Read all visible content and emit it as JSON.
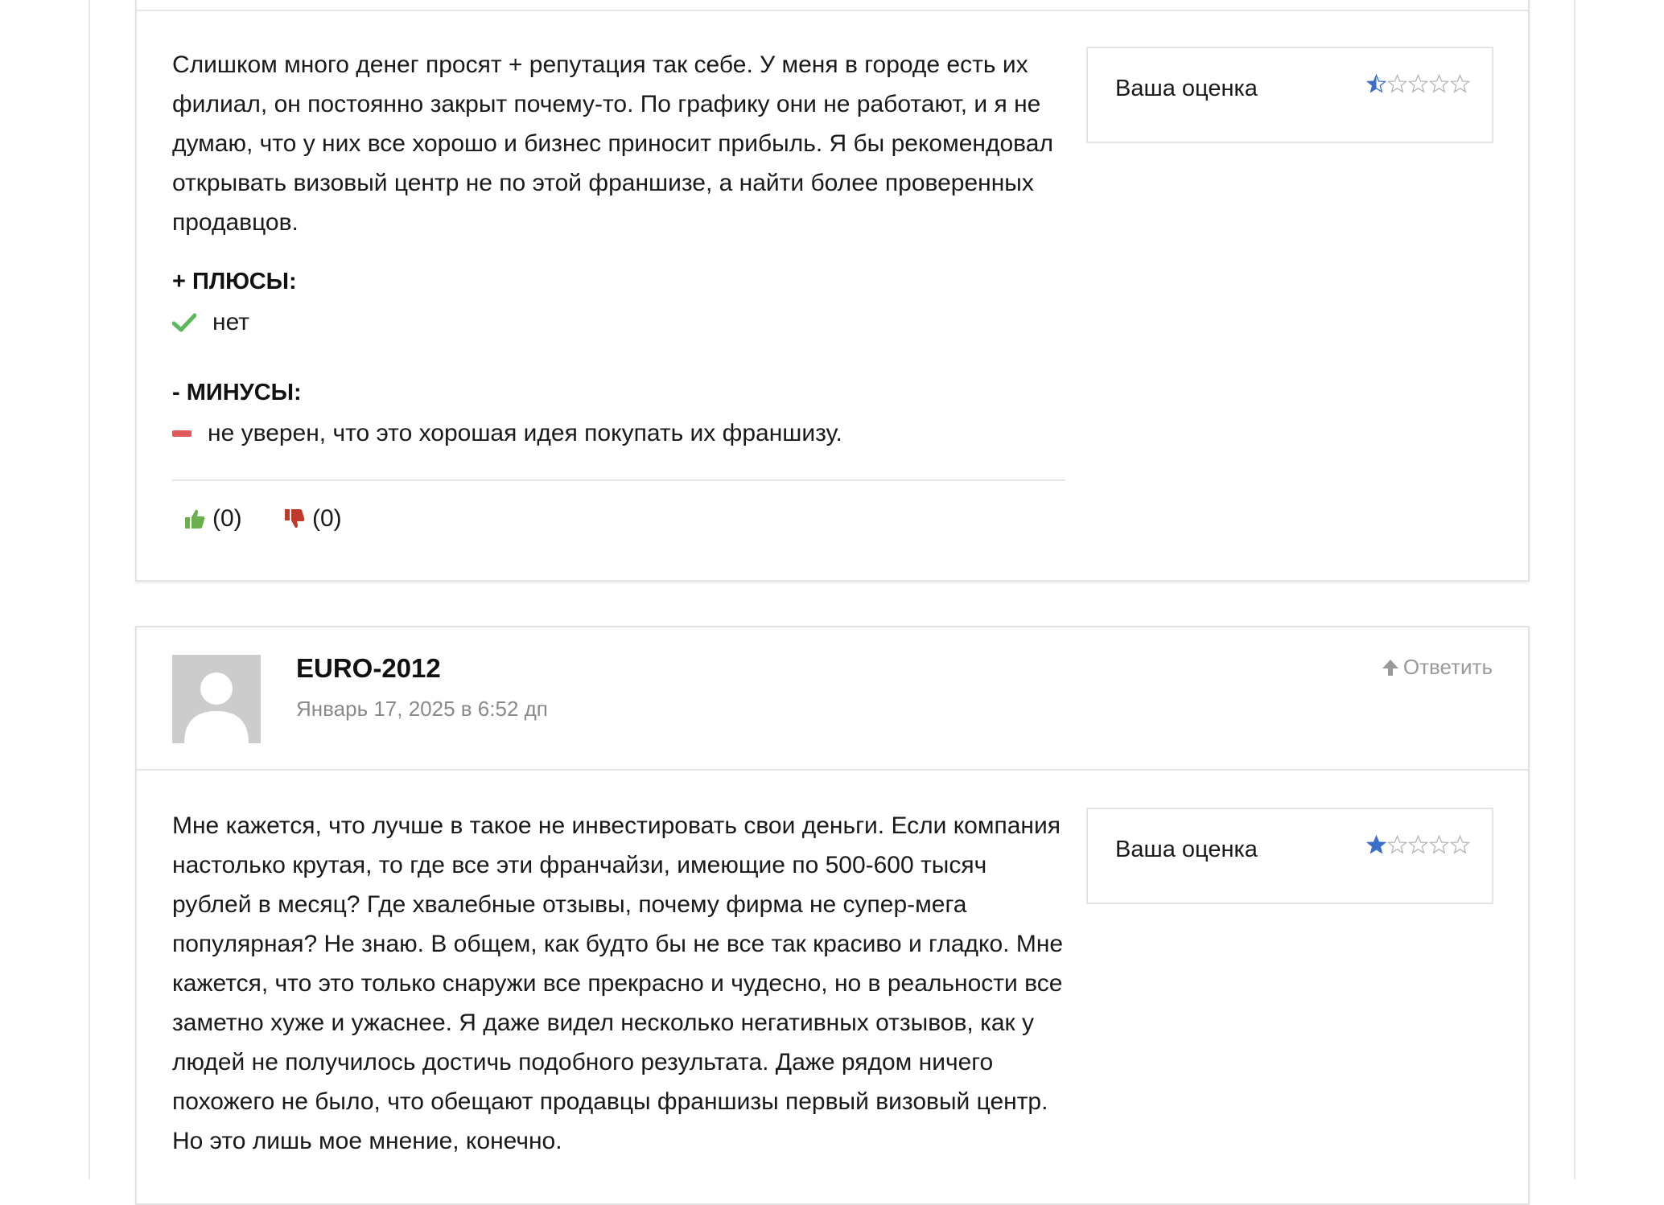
{
  "comments": [
    {
      "text": "Слишком много денег просят + репутация так себе. У меня в городе есть их филиал, он постоянно закрыт почему-то. По графику они не работают, и я не думаю, что у них все хорошо и бизнес приносит прибыль. Я бы рекомендовал открывать визовый центр не по этой франшизе, а найти более проверенных продавцов.",
      "rating_label": "Ваша оценка",
      "rating_value": 0.5,
      "rating_max": 5,
      "pros_title": "+ ПЛЮСЫ:",
      "pros_item": "нет",
      "cons_title": "- МИНУСЫ:",
      "cons_item": "не уверен, что это хорошая идея покупать их франшизу.",
      "likes": "(0)",
      "dislikes": "(0)"
    },
    {
      "author": "EURO-2012",
      "date": "Январь 17, 2025 в 6:52 дп",
      "reply_label": "Ответить",
      "text": "Мне кажется, что лучше в такое не инвестировать свои деньги. Если компания настолько крутая, то где все эти франчайзи, имеющие по 500-600 тысяч рублей в месяц? Где хвалебные отзывы, почему фирма не супер-мега популярная? Не знаю. В общем, как будто бы не все так красиво и гладко. Мне кажется, что это только снаружи все прекрасно и чудесно, но в реальности все заметно хуже и ужаснее. Я даже видел несколько негативных отзывов, как у людей не получилось достичь подобного результата. Даже рядом ничего похожего не было, что обещают продавцы франшизы первый визовый центр. Но это лишь мое мнение, конечно.",
      "rating_label": "Ваша оценка",
      "rating_value": 1,
      "rating_max": 5
    }
  ],
  "colors": {
    "star_fill": "#3b6fc9",
    "check": "#5cb85c",
    "minus": "#e05a5a",
    "thumb_up": "#6ab04c",
    "thumb_down": "#c0392b"
  }
}
